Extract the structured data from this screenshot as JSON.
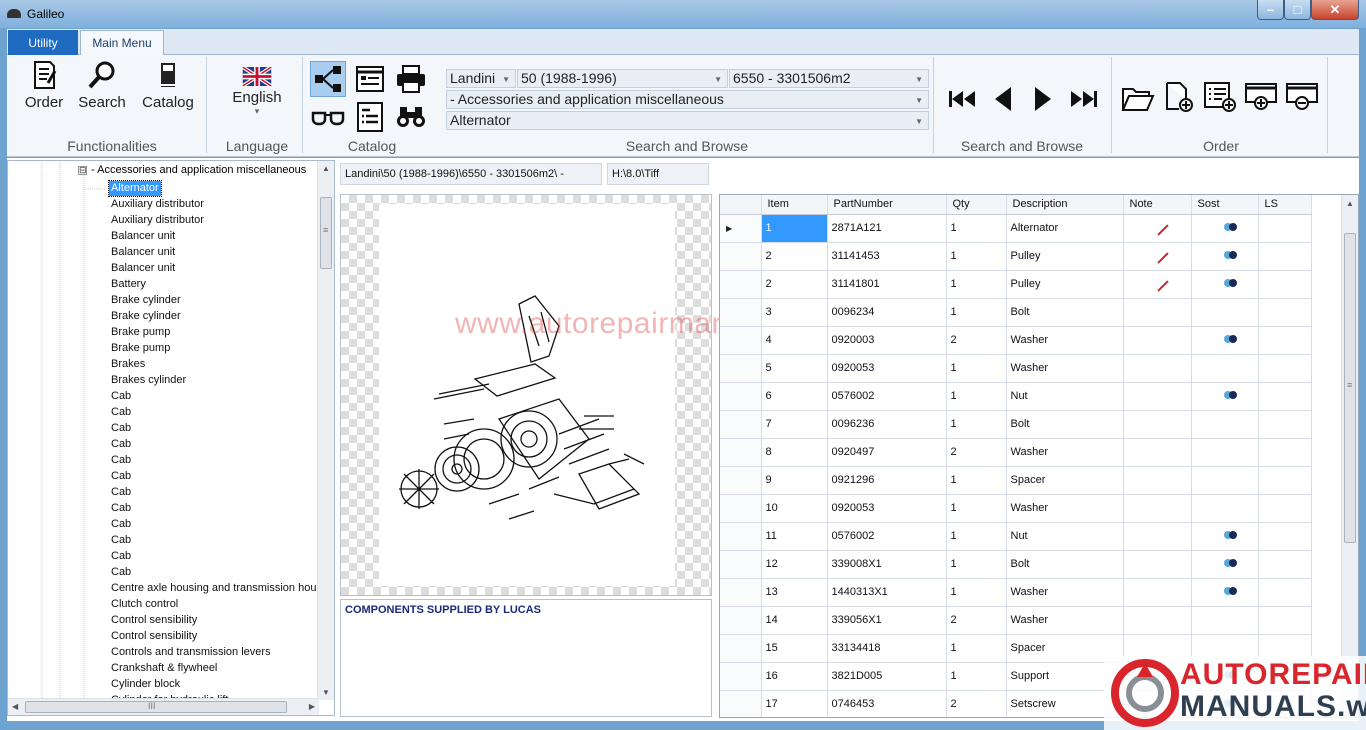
{
  "window": {
    "title": "Galileo"
  },
  "tabs": [
    {
      "label": "Utility"
    },
    {
      "label": "Main Menu"
    }
  ],
  "ribbon": {
    "functionalities": {
      "label": "Functionalities",
      "buttons": [
        {
          "label": "Order",
          "icon": "order-document-icon"
        },
        {
          "label": "Search",
          "icon": "magnifier-icon"
        },
        {
          "label": "Catalog",
          "icon": "book-icon"
        }
      ]
    },
    "language": {
      "label": "Language",
      "value": "English",
      "icon": "uk-flag-icon",
      "arrow": "▾"
    },
    "catalog": {
      "label": "Catalog",
      "icons": [
        "tree-structure-icon",
        "window-list-icon",
        "printer-icon",
        "glasses-icon",
        "document-list-icon",
        "binoculars-icon"
      ]
    },
    "search_browse": {
      "label": "Search and Browse",
      "brand": "Landini",
      "series": "50 (1988-1996)",
      "model": "6550 - 3301506m2",
      "group": "- Accessories and application miscellaneous",
      "part": "Alternator"
    },
    "nav": {
      "label": "Search and Browse",
      "icons": [
        "first-icon",
        "previous-icon",
        "next-icon",
        "last-icon"
      ]
    },
    "order": {
      "label": "Order",
      "icons": [
        "open-folder-icon",
        "new-document-icon",
        "list-add-icon",
        "add-order-icon",
        "remove-order-icon"
      ]
    }
  },
  "tree": {
    "root_toggle": "⊟",
    "root": "- Accessories and application miscellaneous",
    "items": [
      "Alternator",
      "Auxiliary distributor",
      "Auxiliary distributor",
      "Balancer unit",
      "Balancer unit",
      "Balancer unit",
      "Battery",
      "Brake cylinder",
      "Brake cylinder",
      "Brake pump",
      "Brake pump",
      "Brakes",
      "Brakes cylinder",
      "Cab",
      "Cab",
      "Cab",
      "Cab",
      "Cab",
      "Cab",
      "Cab",
      "Cab",
      "Cab",
      "Cab",
      "Cab",
      "Cab",
      "Centre axle housing and transmission housin",
      "Clutch control",
      "Control sensibility",
      "Control sensibility",
      "Controls and transmission levers",
      "Crankshaft & flywheel",
      "Cylinder block",
      "Cylinder for hydraulic lift"
    ],
    "selected_index": 0,
    "scroll_glyphs": {
      "up": "▲",
      "down": "▼",
      "left": "◀",
      "right": "▶",
      "grip": "≡",
      "hgrip": "III"
    }
  },
  "path": {
    "catalog_path": "Landini\\50 (1988-1996)\\6550 - 3301506m2\\ -",
    "image_path": "H:\\8.0\\Tiff"
  },
  "notes": {
    "text": "COMPONENTS SUPPLIED BY LUCAS"
  },
  "watermark": "www.autorepairmanuals.ws",
  "logo": {
    "line1": "AUTOREPAIR",
    "line2": "MANUALS.ws"
  },
  "grid": {
    "columns": [
      "Item",
      "PartNumber",
      "Qty",
      "Description",
      "Note",
      "Sost",
      "LS"
    ],
    "current_row_marker": "▶",
    "rows": [
      {
        "item": "1",
        "part": "2871A121",
        "qty": "1",
        "desc": "Alternator",
        "note": true,
        "sost": true
      },
      {
        "item": "2",
        "part": "31141453",
        "qty": "1",
        "desc": "Pulley",
        "note": true,
        "sost": true
      },
      {
        "item": "2",
        "part": "31141801",
        "qty": "1",
        "desc": "Pulley",
        "note": true,
        "sost": true
      },
      {
        "item": "3",
        "part": "0096234",
        "qty": "1",
        "desc": "Bolt",
        "note": false,
        "sost": false
      },
      {
        "item": "4",
        "part": "0920003",
        "qty": "2",
        "desc": "Washer",
        "note": false,
        "sost": true
      },
      {
        "item": "5",
        "part": "0920053",
        "qty": "1",
        "desc": "Washer",
        "note": false,
        "sost": false
      },
      {
        "item": "6",
        "part": "0576002",
        "qty": "1",
        "desc": "Nut",
        "note": false,
        "sost": true
      },
      {
        "item": "7",
        "part": "0096236",
        "qty": "1",
        "desc": "Bolt",
        "note": false,
        "sost": false
      },
      {
        "item": "8",
        "part": "0920497",
        "qty": "2",
        "desc": "Washer",
        "note": false,
        "sost": false
      },
      {
        "item": "9",
        "part": "0921296",
        "qty": "1",
        "desc": "Spacer",
        "note": false,
        "sost": false
      },
      {
        "item": "10",
        "part": "0920053",
        "qty": "1",
        "desc": "Washer",
        "note": false,
        "sost": false
      },
      {
        "item": "11",
        "part": "0576002",
        "qty": "1",
        "desc": "Nut",
        "note": false,
        "sost": true
      },
      {
        "item": "12",
        "part": "339008X1",
        "qty": "1",
        "desc": "Bolt",
        "note": false,
        "sost": true
      },
      {
        "item": "13",
        "part": "1440313X1",
        "qty": "1",
        "desc": "Washer",
        "note": false,
        "sost": true
      },
      {
        "item": "14",
        "part": "339056X1",
        "qty": "2",
        "desc": "Washer",
        "note": false,
        "sost": false
      },
      {
        "item": "15",
        "part": "33134418",
        "qty": "1",
        "desc": "Spacer",
        "note": false,
        "sost": false
      },
      {
        "item": "16",
        "part": "3821D005",
        "qty": "1",
        "desc": "Support",
        "note": false,
        "sost": true
      },
      {
        "item": "17",
        "part": "0746453",
        "qty": "2",
        "desc": "Setscrew",
        "note": false,
        "sost": true
      }
    ]
  }
}
